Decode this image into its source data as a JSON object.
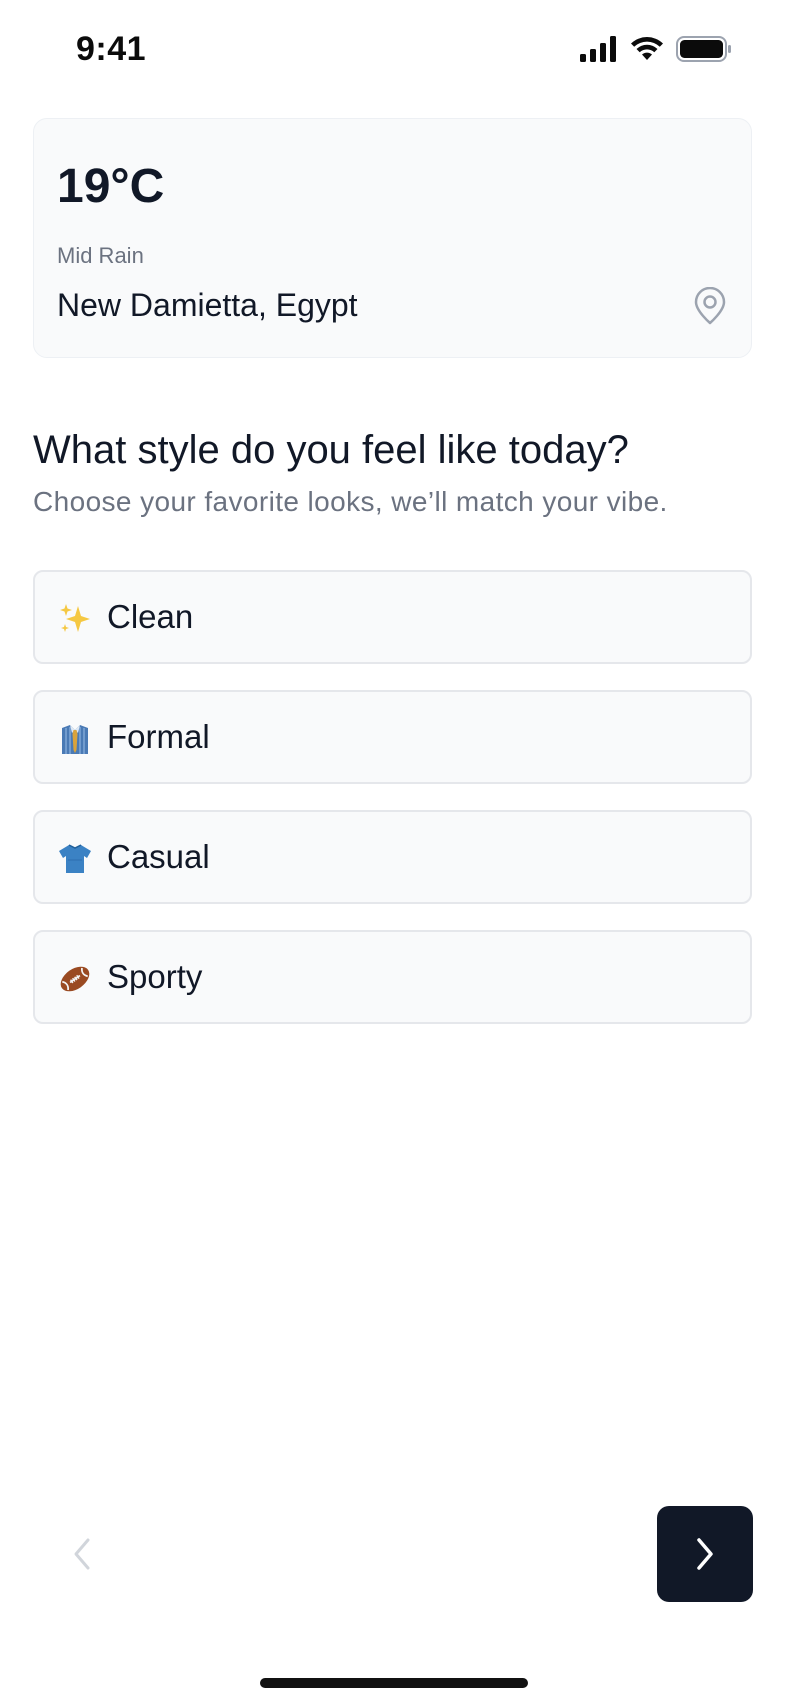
{
  "status_bar": {
    "time": "9:41",
    "icons": [
      "signal-icon",
      "wifi-icon",
      "battery-icon"
    ]
  },
  "weather": {
    "temperature": "19°C",
    "condition": "Mid Rain",
    "location": "New Damietta, Egypt",
    "location_icon": "location-pin-icon"
  },
  "question": {
    "title": "What style do you feel like today?",
    "subtitle": "Choose your favorite looks, we’ll match your vibe."
  },
  "options": [
    {
      "label": "Clean",
      "icon": "sparkles-icon"
    },
    {
      "label": "Formal",
      "icon": "shirt-tie-icon"
    },
    {
      "label": "Casual",
      "icon": "tshirt-icon"
    },
    {
      "label": "Sporty",
      "icon": "football-icon"
    }
  ],
  "navigation": {
    "prev_icon": "chevron-left-icon",
    "next_icon": "chevron-right-icon"
  },
  "colors": {
    "primary": "#111827",
    "muted_text": "#6b7280",
    "card_bg": "#f9fafb",
    "border": "#e5e7eb"
  }
}
